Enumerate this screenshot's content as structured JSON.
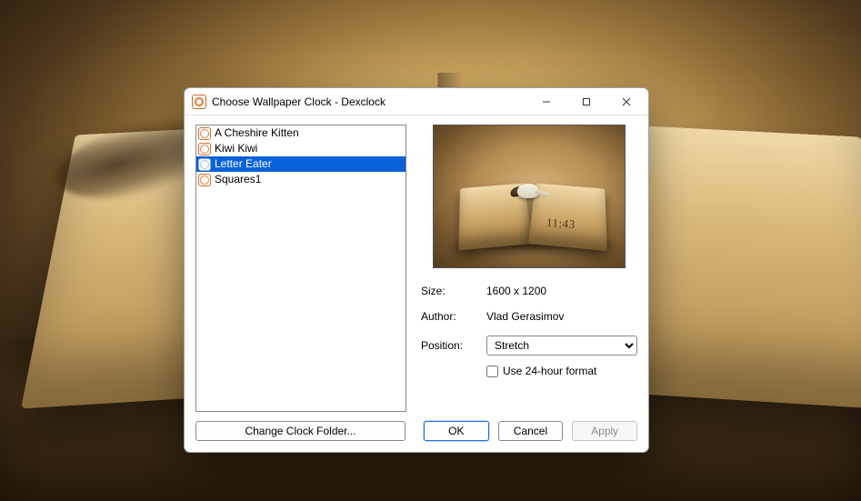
{
  "window": {
    "title": "Choose Wallpaper Clock - Dexclock"
  },
  "list": {
    "items": [
      {
        "label": "A Cheshire Kitten",
        "selected": false
      },
      {
        "label": "Kiwi Kiwi",
        "selected": false
      },
      {
        "label": "Letter Eater",
        "selected": true
      },
      {
        "label": "Squares1",
        "selected": false
      }
    ]
  },
  "preview": {
    "time_overlay": "11:43"
  },
  "details": {
    "size_label": "Size:",
    "size_value": "1600 x 1200",
    "author_label": "Author:",
    "author_value": "Vlad Gerasimov",
    "position_label": "Position:",
    "position_value": "Stretch",
    "position_options": [
      "Stretch"
    ],
    "checkbox_label": "Use 24-hour format",
    "checkbox_checked": false
  },
  "buttons": {
    "change_folder": "Change Clock Folder...",
    "ok": "OK",
    "cancel": "Cancel",
    "apply": "Apply"
  }
}
